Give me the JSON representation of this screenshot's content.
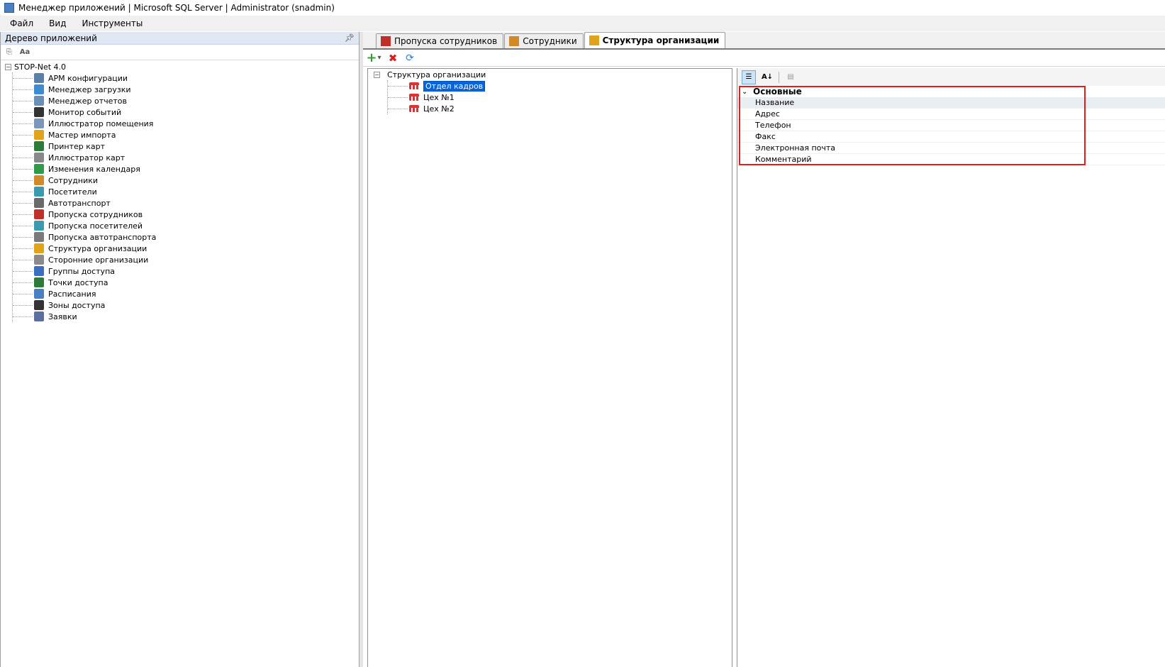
{
  "window": {
    "title": "Менеджер приложений | Microsoft SQL Server | Administrator  (snadmin)"
  },
  "menu": {
    "items": [
      "Файл",
      "Вид",
      "Инструменты"
    ]
  },
  "left_panel": {
    "title": "Дерево приложений",
    "root": "STOP-Net 4.0",
    "items": [
      {
        "label": "АРМ конфигурации",
        "icon": "config-workstation-icon",
        "color": "#5b7fa6"
      },
      {
        "label": "Менеджер загрузки",
        "icon": "download-manager-icon",
        "color": "#3d8bd0"
      },
      {
        "label": "Менеджер отчетов",
        "icon": "reports-icon",
        "color": "#6a8fb5"
      },
      {
        "label": "Монитор событий",
        "icon": "eye-icon",
        "color": "#333333"
      },
      {
        "label": "Иллюстратор помещения",
        "icon": "room-illustrator-icon",
        "color": "#7a96b8"
      },
      {
        "label": "Мастер импорта",
        "icon": "import-wizard-icon",
        "color": "#e0a31a"
      },
      {
        "label": "Принтер карт",
        "icon": "card-printer-icon",
        "color": "#2d7a3a"
      },
      {
        "label": "Иллюстратор карт",
        "icon": "card-illustrator-icon",
        "color": "#888888"
      },
      {
        "label": "Изменения календаря",
        "icon": "calendar-icon",
        "color": "#2e9a4a"
      },
      {
        "label": "Сотрудники",
        "icon": "employees-icon",
        "color": "#d08a2a"
      },
      {
        "label": "Посетители",
        "icon": "visitors-icon",
        "color": "#3a9ab0"
      },
      {
        "label": "Автотранспорт",
        "icon": "car-icon",
        "color": "#6a6a6a"
      },
      {
        "label": "Пропуска сотрудников",
        "icon": "employee-pass-icon",
        "color": "#c0302a"
      },
      {
        "label": "Пропуска посетителей",
        "icon": "visitor-pass-icon",
        "color": "#3a9ab0"
      },
      {
        "label": "Пропуска автотранспорта",
        "icon": "vehicle-pass-icon",
        "color": "#7a7a7a"
      },
      {
        "label": "Структура организации",
        "icon": "org-structure-icon",
        "color": "#e0a31a"
      },
      {
        "label": "Сторонние организации",
        "icon": "external-org-icon",
        "color": "#8a8a8a"
      },
      {
        "label": "Группы доступа",
        "icon": "access-groups-icon",
        "color": "#3a6fc0"
      },
      {
        "label": "Точки доступа",
        "icon": "access-points-icon",
        "color": "#2d7a3a"
      },
      {
        "label": "Расписания",
        "icon": "schedule-icon",
        "color": "#4a7fc1"
      },
      {
        "label": "Зоны доступа",
        "icon": "access-zones-icon",
        "color": "#333333"
      },
      {
        "label": "Заявки",
        "icon": "requests-icon",
        "color": "#5a6fa0"
      }
    ]
  },
  "tabs": [
    {
      "label": "Пропуска сотрудников",
      "icon": "employee-pass-icon",
      "color": "#c0302a"
    },
    {
      "label": "Сотрудники",
      "icon": "employees-icon",
      "color": "#d08a2a"
    },
    {
      "label": "Структура организации",
      "icon": "org-structure-icon",
      "color": "#e0a31a"
    }
  ],
  "org_tree": {
    "root": "Структура организации",
    "items": [
      "Отдел кадров",
      "Цех №1",
      "Цех №2"
    ]
  },
  "property_grid": {
    "category": "Основные",
    "rows": [
      "Название",
      "Адрес",
      "Телефон",
      "Факс",
      "Электронная почта",
      "Комментарий"
    ]
  }
}
